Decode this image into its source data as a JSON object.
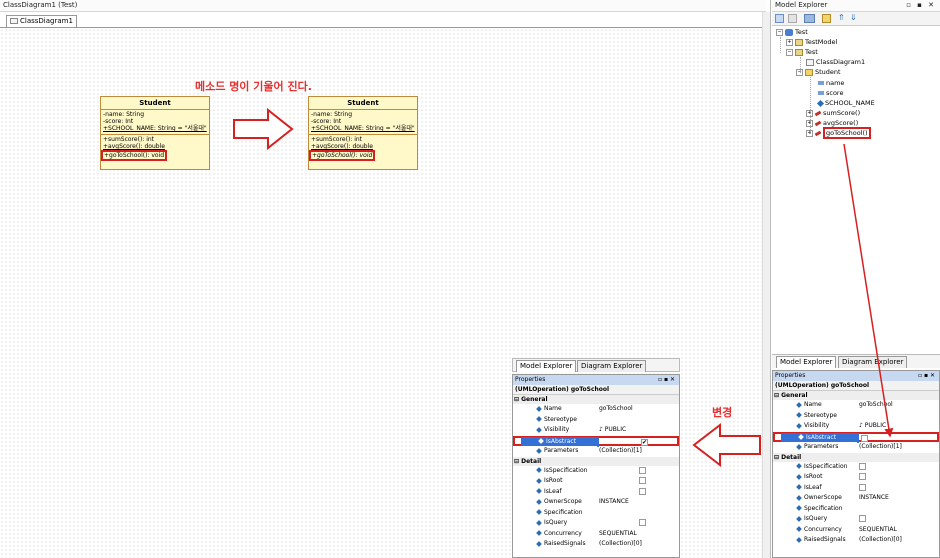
{
  "main_window": {
    "title": "ClassDiagram1 (Test)",
    "tab": "ClassDiagram1"
  },
  "annotations": {
    "top_label": "메소드 명이 기울어 진다.",
    "change_label": "변경"
  },
  "uml_left": {
    "name": "Student",
    "attrs": [
      "-name: String",
      "-score: Int",
      "+SCHOOL_NAME: String = \"서울대\""
    ],
    "ops": [
      "+sumScore(): int",
      "+avgScore(): double",
      "+goToSchool(): void"
    ]
  },
  "uml_right": {
    "name": "Student",
    "attrs": [
      "-name: String",
      "-score: Int",
      "+SCHOOL_NAME: String = \"서울대\""
    ],
    "ops": [
      "+sumScore(): int",
      "+avgScore(): double",
      "+goToSchool(): void"
    ]
  },
  "model_explorer": {
    "title": "Model Explorer",
    "tree": [
      "Test",
      "TestModel",
      "Test",
      "ClassDiagram1",
      "Student",
      "name",
      "score",
      "SCHOOL_NAME",
      "sumScore()",
      "avgScore()",
      "goToSchool()"
    ]
  },
  "bottom_tabs": {
    "model": "Model Explorer",
    "diagram": "Diagram Explorer"
  },
  "properties": {
    "title": "Properties",
    "object": "(UMLOperation) goToSchool",
    "general": "General",
    "detail": "Detail",
    "rows": {
      "name": {
        "label": "Name",
        "value": "goToSchool"
      },
      "stereotype": {
        "label": "Stereotype",
        "value": ""
      },
      "visibility": {
        "label": "Visibility",
        "value": "PUBLIC"
      },
      "isabstract": {
        "label": "IsAbstract",
        "value": ""
      },
      "parameters": {
        "label": "Parameters",
        "value": "(Collection)[1]"
      },
      "isspec": {
        "label": "IsSpecification",
        "value": ""
      },
      "isroot": {
        "label": "IsRoot",
        "value": ""
      },
      "isleaf": {
        "label": "IsLeaf",
        "value": ""
      },
      "ownerscope": {
        "label": "OwnerScope",
        "value": "INSTANCE"
      },
      "specification": {
        "label": "Specification",
        "value": ""
      },
      "isquery": {
        "label": "IsQuery",
        "value": ""
      },
      "concurrency": {
        "label": "Concurrency",
        "value": "SEQUENTIAL"
      },
      "raisedsignals": {
        "label": "RaisedSignals",
        "value": "(Collection)[0]"
      }
    }
  },
  "colors": {
    "accent_red": "#e53030",
    "selection_blue": "#3371d6",
    "uml_fill": "#fff8c8"
  }
}
